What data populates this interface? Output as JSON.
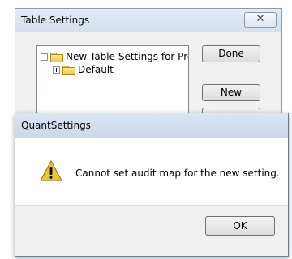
{
  "back_window": {
    "title": "Table Settings",
    "close_glyph": "✕",
    "tree": {
      "root_label": "New Table Settings for Proj",
      "child_label": "Default"
    },
    "buttons": {
      "done": "Done",
      "new": "New",
      "partial": "..."
    }
  },
  "dialog": {
    "title": "QuantSettings",
    "message": "Cannot set audit map for the new setting.",
    "ok_label": "OK",
    "icon": "warning-icon"
  },
  "colors": {
    "warning_yellow": "#f2c12e",
    "titlebar": "#d4e0ee"
  }
}
